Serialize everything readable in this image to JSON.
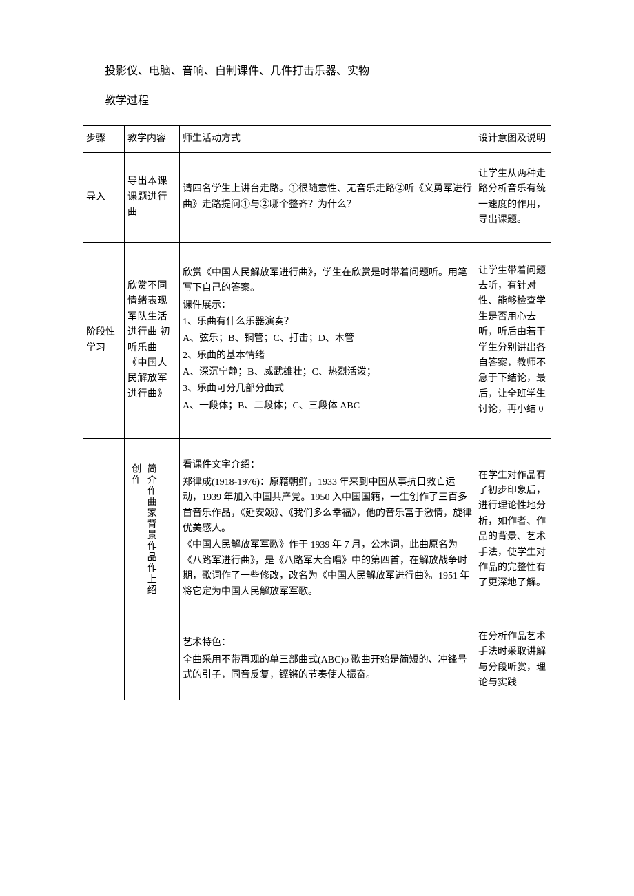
{
  "pretext": {
    "line1": "投影仪、电脑、音响、自制课件、几件打击乐器、实物",
    "line2": "教学过程"
  },
  "header": {
    "c1": "步骤",
    "c2": "教学内容",
    "c3": "师生活动方式",
    "c4": "设计意图及说明"
  },
  "rows": {
    "r1": {
      "step": "导入",
      "content": "导出本课课题进行曲",
      "activity": "请四名学生上讲台走路。①很随意性、无音乐走路②听《义勇军进行曲》走路提问①与②哪个整齐？为什么？",
      "design": "让学生从两种走路分析音乐有统一速度的作用，导出课题。"
    },
    "r2": {
      "step": "阶段性学习",
      "content": "欣赏不同情绪表现军队生活进行曲 初听乐曲《中国人民解放军进行曲》",
      "activity": {
        "p1": "欣赏《中国人民解放军进行曲》，学生在欣赏是时带着问题听。用笔写下自己的答案。",
        "p2": "课件展示：",
        "p3": "1、乐曲有什么乐器演奏？",
        "p4": "A、弦乐；B、铜管；C、打击；D、木管",
        "p5": "2、乐曲的基本情绪",
        "p6": "A、深沉宁静；B、威武雄壮；C、热烈活泼；",
        "p7": "3、乐曲可分几部分曲式",
        "p8": "A、一段体；B、二段体；C、三段体 ABC"
      },
      "design": "让学生带着问题去听，有针对性、能够检查学生是否用心去听，听后由若干学生分别讲出各自答案，教师不急于下结论，最后，让全班学生讨论，再小结 0"
    },
    "r3": {
      "content": "简介作曲家背景作品作上绍创作",
      "activity": {
        "p1": "看课件文字介绍：",
        "p2": "郑律成(1918-1976)：原籍朝鲜，1933 年来到中国从事抗日救亡运动，1939 年加入中国共产党。1950 入中国国籍，一生创作了三百多首音乐作品，《延安颂》、《我们多么幸福》，他的音乐富于激情，旋律优美感人。",
        "p3": "《中国人民解放军军歌》作于 1939 年 7 月，公木词，此曲原名为《八路军进行曲》，是《八路军大合唱》中的第四首，在解放战争时期，歌词作了一些修改，改名为《中国人民解放军进行曲》。1951 年将它定为中国人民解放军军歌。"
      },
      "design": "在学生对作品有了初步印象后，进行理论性地分析，如作者、作品的背景、艺术手法，使学生对作品的完整性有了更深地了解。"
    },
    "r4": {
      "activity": {
        "p1": "艺术特色：",
        "p2": "全曲采用不带再现的单三部曲式(ABC)o 歌曲开始是简短的、冲锋号式的引子，同音反复，铿锵的节奏使人振奋。"
      },
      "design": "在分析作品艺术手法时采取讲解与分段听赏，理论与实践"
    }
  }
}
